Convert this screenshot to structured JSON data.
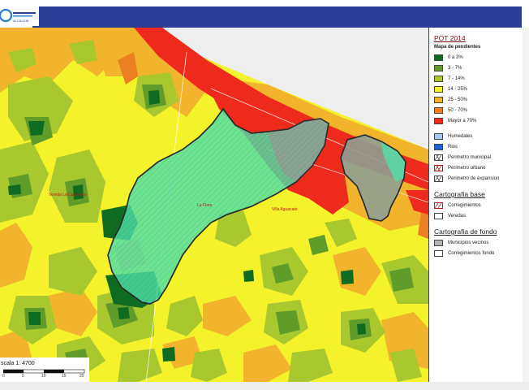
{
  "header": {
    "logo_text": "ALCALDÍA",
    "colors": {
      "bar": "#2b3f96",
      "background": "#ffffff"
    }
  },
  "map": {
    "place_labels": [
      "Vereda La Cabecera",
      "La Flora",
      "Villa Aguacate"
    ],
    "colors": {
      "slope_0_3": "#0f6b1f",
      "slope_3_7": "#5f9c2a",
      "slope_7_14": "#a8c82e",
      "slope_14_25": "#f4f22a",
      "slope_25_50": "#f1b42c",
      "slope_50_70": "#eb7f22",
      "slope_over_70": "#ee2a1c",
      "urban_perimeter_fill": "#4fe0a8",
      "expansion_perimeter_fill": "#8f9f94"
    }
  },
  "legend": {
    "title": "POT 2014",
    "slope_subtitle": "Mapa de pendientes",
    "slope_items": [
      {
        "label": "0 a 3%",
        "color": "#0f6b1f"
      },
      {
        "label": "3 - 7%",
        "color": "#5f9c2a"
      },
      {
        "label": "7 - 14%",
        "color": "#a8c82e"
      },
      {
        "label": "14 - 25%",
        "color": "#f4f22a"
      },
      {
        "label": "25 - 50%",
        "color": "#f1b42c"
      },
      {
        "label": "50 - 70%",
        "color": "#eb7f22"
      },
      {
        "label": "Mayor a 70%",
        "color": "#ee2a1c"
      }
    ],
    "water_items": [
      {
        "label": "Humedales",
        "color": "#a9cbf2"
      },
      {
        "label": "Rios",
        "color": "#1f64dd"
      }
    ],
    "perimeter_items": [
      {
        "label": "Perimetro municipal",
        "icon": "hatched-perimeter-icon",
        "color": "#444444"
      },
      {
        "label": "Perimetro urbano",
        "icon": "hatched-perimeter-icon",
        "color": "#c01818"
      },
      {
        "label": "Perimetro de expansion",
        "icon": "hatched-perimeter-icon",
        "color": "#444444"
      }
    ],
    "base_title": "Cartografia base",
    "base_items": [
      {
        "label": "Corregimientos",
        "icon": "hatched-perimeter-icon",
        "color": "#c01818"
      },
      {
        "label": "Veredas",
        "color": "#ffffff"
      }
    ],
    "background_title": "Cartografia de fondo",
    "background_items": [
      {
        "label": "Municipios vecinos",
        "color": "#b4b4b4"
      },
      {
        "label": "Corregimientos fondo",
        "color": "#ffffff"
      }
    ]
  },
  "scale": {
    "label": "scala 1: 4700",
    "ticks": [
      "0",
      "5",
      "10",
      "15",
      "20"
    ]
  }
}
